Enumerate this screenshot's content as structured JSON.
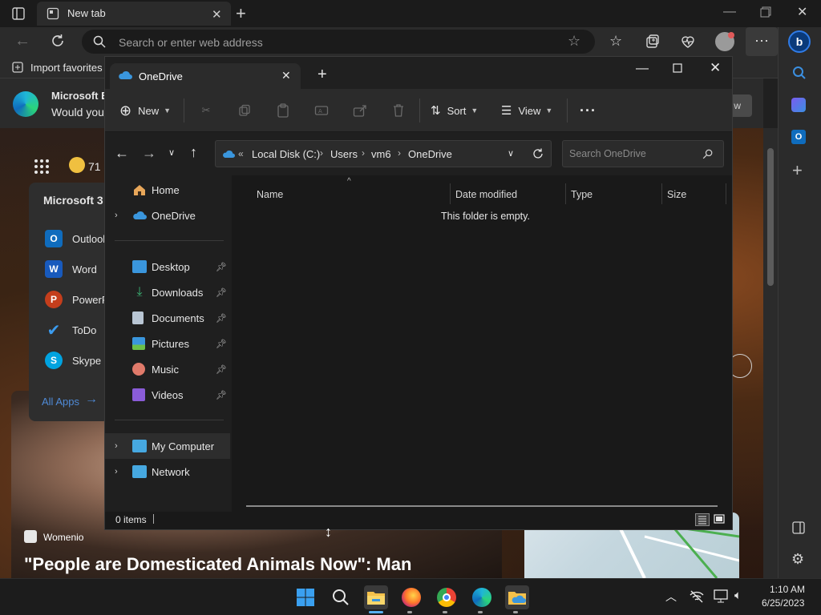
{
  "browser": {
    "tab_title": "New tab",
    "address_placeholder": "Search or enter web address",
    "favorites_item": "Import favorites"
  },
  "ntp": {
    "banner_title": "Microsoft E",
    "banner_subtitle": "Would you",
    "weather_temp": "71",
    "m365_title": "Microsoft 3",
    "apps": [
      {
        "label": "Outlook"
      },
      {
        "label": "Word"
      },
      {
        "label": "PowerP"
      },
      {
        "label": "ToDo"
      },
      {
        "label": "Skype"
      }
    ],
    "all_apps": "All Apps",
    "news_source": "Womenio",
    "news_headline": "\"People are Domesticated Animals Now\": Man",
    "banner_button": "w"
  },
  "explorer": {
    "tab_title": "OneDrive",
    "toolbar": {
      "new_label": "New",
      "sort_label": "Sort",
      "view_label": "View"
    },
    "breadcrumb": [
      "Local Disk (C:)",
      "Users",
      "vm6",
      "OneDrive"
    ],
    "search_placeholder": "Search OneDrive",
    "nav": {
      "home": "Home",
      "onedrive": "OneDrive",
      "pinned": [
        "Desktop",
        "Downloads",
        "Documents",
        "Pictures",
        "Music",
        "Videos"
      ],
      "my_computer": "My Computer",
      "network": "Network"
    },
    "columns": [
      "Name",
      "Date modified",
      "Type",
      "Size"
    ],
    "empty_message": "This folder is empty.",
    "status": "0 items"
  },
  "taskbar": {
    "time": "1:10 AM",
    "date": "6/25/2023"
  },
  "colors": {
    "accent": "#0078d4",
    "onedrive_blue": "#3a96dd",
    "folder_yellow": "#f4c14b"
  }
}
